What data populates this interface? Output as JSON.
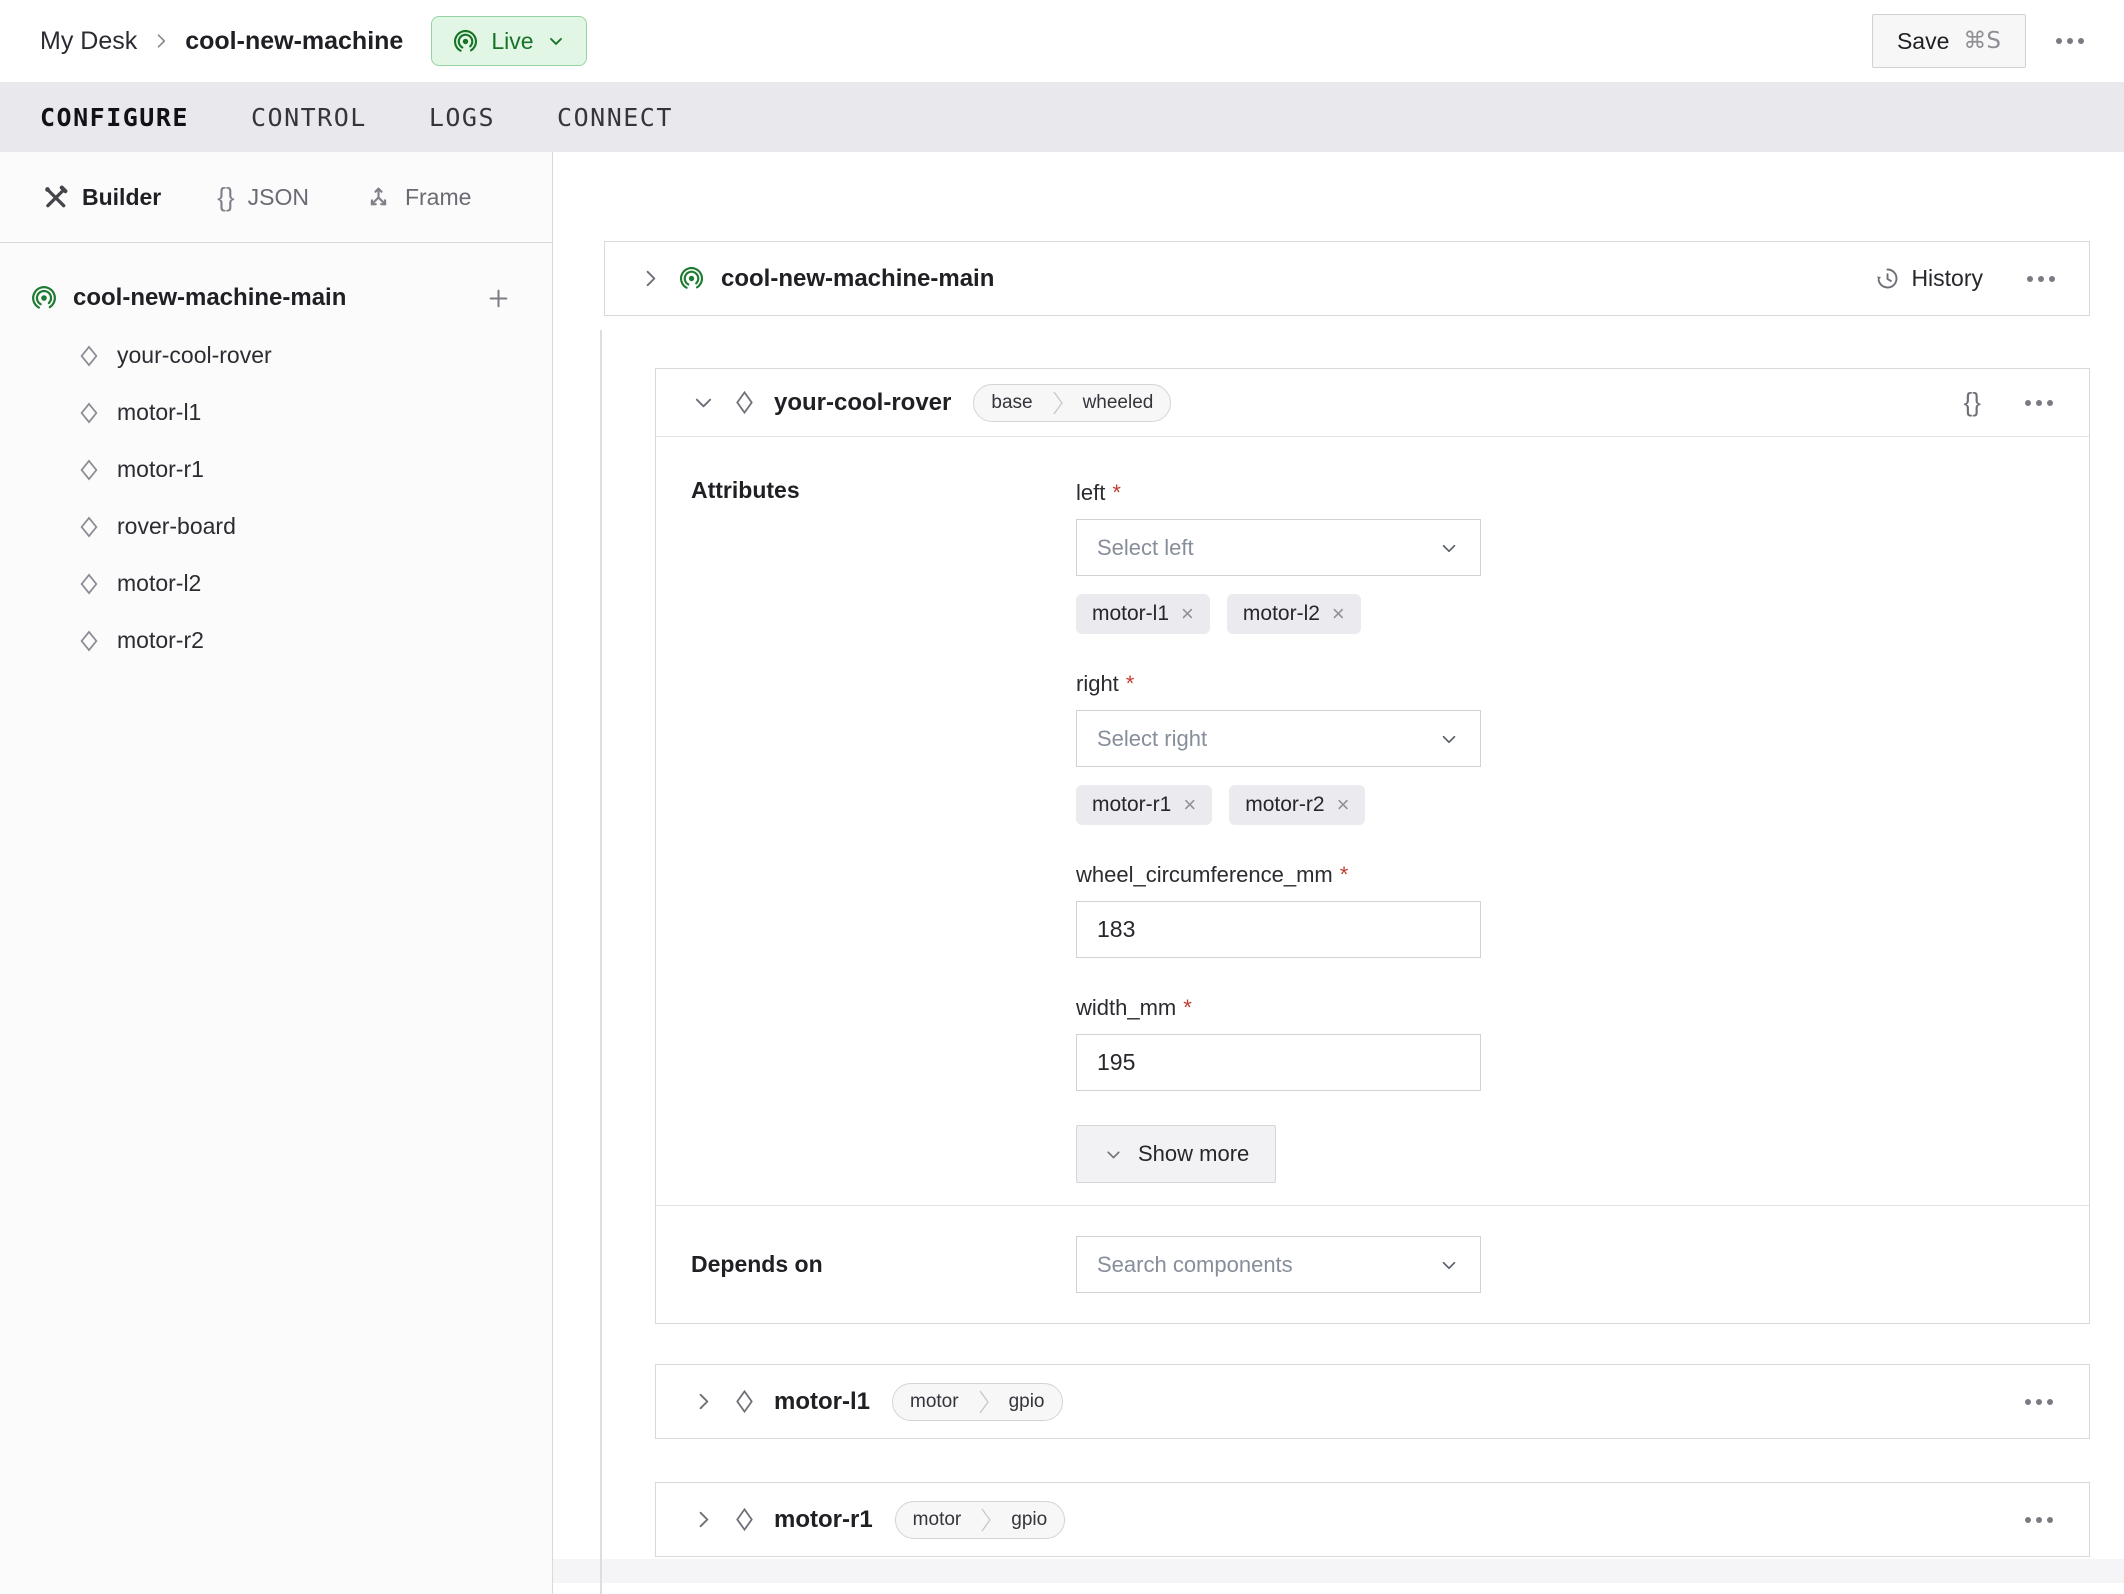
{
  "topbar": {
    "breadcrumb": {
      "parent": "My Desk",
      "current": "cool-new-machine"
    },
    "live_label": "Live",
    "save_label": "Save",
    "save_shortcut": "⌘S"
  },
  "tabs": [
    {
      "label": "CONFIGURE",
      "active": true
    },
    {
      "label": "CONTROL",
      "active": false
    },
    {
      "label": "LOGS",
      "active": false
    },
    {
      "label": "CONNECT",
      "active": false
    }
  ],
  "sidebar": {
    "modes": [
      {
        "label": "Builder",
        "icon": "tools-icon",
        "active": true
      },
      {
        "label": "JSON",
        "icon": "braces-icon",
        "active": false
      },
      {
        "label": "Frame",
        "icon": "frame-axes-icon",
        "active": false
      }
    ],
    "tree": {
      "root": "cool-new-machine-main",
      "children": [
        "your-cool-rover",
        "motor-l1",
        "motor-r1",
        "rover-board",
        "motor-l2",
        "motor-r2"
      ]
    }
  },
  "main": {
    "part_card": {
      "title": "cool-new-machine-main",
      "history_label": "History"
    },
    "rover_card": {
      "title": "your-cool-rover",
      "tags": [
        "base",
        "wheeled"
      ],
      "attributes_label": "Attributes",
      "fields": [
        {
          "label": "left",
          "required": true,
          "placeholder": "Select left",
          "chips": [
            "motor-l1",
            "motor-l2"
          ]
        },
        {
          "label": "right",
          "required": true,
          "placeholder": "Select right",
          "chips": [
            "motor-r1",
            "motor-r2"
          ]
        },
        {
          "label": "wheel_circumference_mm",
          "required": true,
          "value": "183"
        },
        {
          "label": "width_mm",
          "required": true,
          "value": "195"
        }
      ],
      "show_more_label": "Show more",
      "depends_label": "Depends on",
      "depends_placeholder": "Search components"
    },
    "component_cards": [
      {
        "title": "motor-l1",
        "tags": [
          "motor",
          "gpio"
        ]
      },
      {
        "title": "motor-r1",
        "tags": [
          "motor",
          "gpio"
        ]
      }
    ]
  },
  "colors": {
    "live_text": "#187327",
    "live_bg": "#e2f6e5",
    "live_border": "#97d3a2",
    "required_red": "#c43d31",
    "tabbar_bg": "#e9e9ed"
  }
}
